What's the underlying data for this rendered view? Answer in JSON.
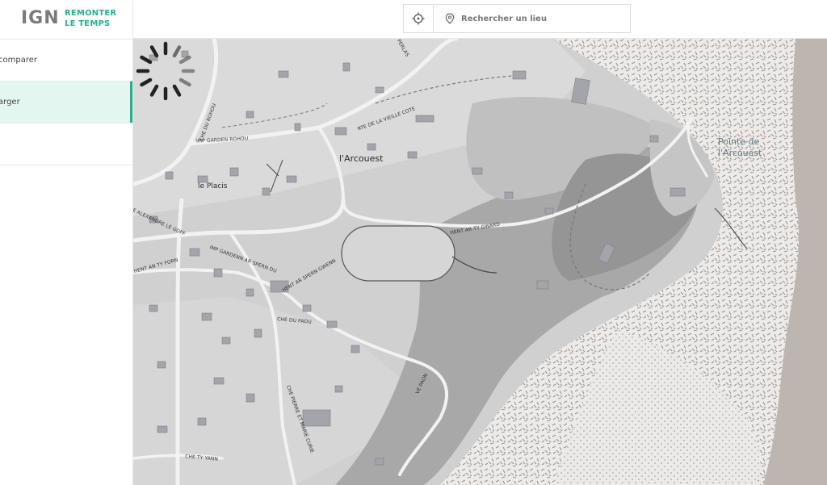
{
  "brand": {
    "logo": "IGN",
    "tagline_line1": "REMONTER",
    "tagline_line2": "LE TEMPS"
  },
  "sidebar": {
    "items": [
      {
        "label": "comparer",
        "active": false
      },
      {
        "label": "arger",
        "active": true
      },
      {
        "label": "",
        "active": false
      }
    ]
  },
  "search": {
    "placeholder": "Rechercher un lieu",
    "value": ""
  },
  "map": {
    "places": {
      "arcouest": "l'Arcouest",
      "placis": "le Placis",
      "pointe_line1": "Pointe de",
      "pointe_line2": "l'Arcouest"
    },
    "streets": {
      "perlas": "PERLAS",
      "che_du_rohou": "CHE DU ROHOU",
      "imp_garden_rohou": "IMP GARDEN ROHOU",
      "rte_vieille_cote": "RTE DE LA VIEILLE COTE",
      "alexandre_le_goff": "E ALEXANDRE LE GOFF",
      "hent_ty_forn": "HENT AN TY FORN",
      "imp_garden_spern": "IMP GARDENN AR SPERN DU",
      "hent_spern_gwenn": "HENT AR SPERN GWENN",
      "hent_ty_gward": "HENT AR TY GWARD",
      "che_du_padu": "CHE DU PADU",
      "ve_paon": "VE PAON",
      "che_pierre_marie_curie": "CHE PIERRE ET MARIE CURIE",
      "che_ty_yann": "CHE TY YANN"
    }
  },
  "colors": {
    "accent": "#27ad8f",
    "active_bg": "#e3f6f0"
  },
  "icons": {
    "locate": "crosshair-icon",
    "search": "map-pin-icon",
    "loading": "spinner-icon"
  }
}
